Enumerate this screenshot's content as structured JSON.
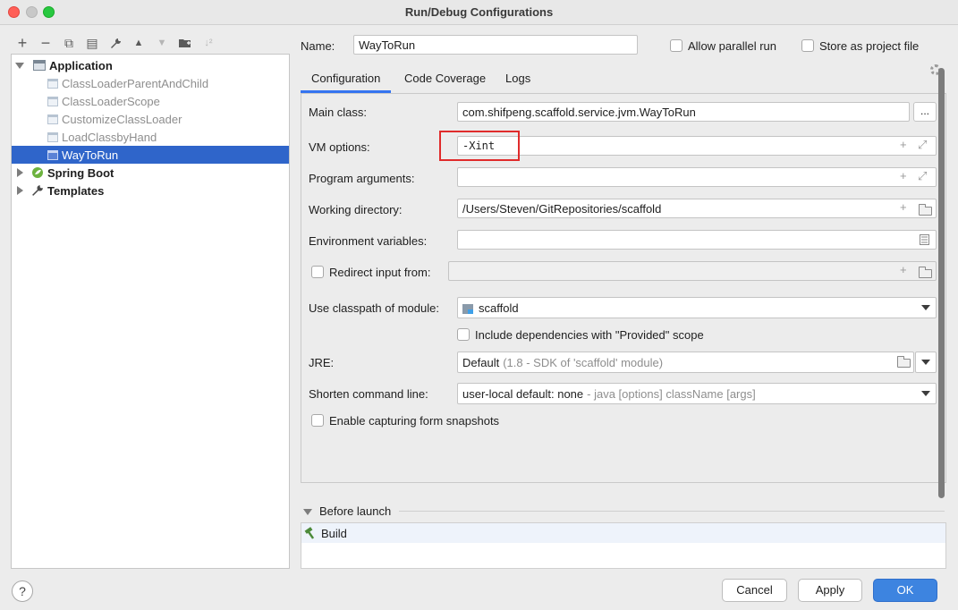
{
  "window": {
    "title": "Run/Debug Configurations"
  },
  "toolbar": {
    "add": "+",
    "remove": "−",
    "copy": "⧉",
    "save": "▤",
    "edit": "🔧",
    "up": "▲",
    "down": "▼",
    "folder": "📁",
    "sort": "↓²"
  },
  "tree": {
    "application": "Application",
    "items": [
      "ClassLoaderParentAndChild",
      "ClassLoaderScope",
      "CustomizeClassLoader",
      "LoadClassbyHand",
      "WayToRun"
    ],
    "spring_boot": "Spring Boot",
    "templates": "Templates"
  },
  "header": {
    "name_label": "Name:",
    "name_value": "WayToRun",
    "allow_parallel": "Allow parallel run",
    "store_project": "Store as project file"
  },
  "tabs": [
    "Configuration",
    "Code Coverage",
    "Logs"
  ],
  "config": {
    "main_class_label": "Main class:",
    "main_class_value": "com.shifpeng.scaffold.service.jvm.WayToRun",
    "more_btn": "...",
    "vm_label": "VM options:",
    "vm_value": "-Xint",
    "prog_args_label": "Program arguments:",
    "prog_args_value": "",
    "workdir_label": "Working directory:",
    "workdir_value": "/Users/Steven/GitRepositories/scaffold",
    "env_label": "Environment variables:",
    "env_value": "",
    "redirect_label": "Redirect input from:",
    "classpath_label": "Use classpath of module:",
    "classpath_value": "scaffold",
    "include_deps": "Include dependencies with \"Provided\" scope",
    "jre_label": "JRE:",
    "jre_value": "Default",
    "jre_detail": "(1.8 - SDK of 'scaffold' module)",
    "shorten_label": "Shorten command line:",
    "shorten_value": "user-local default: none",
    "shorten_detail": "- java [options] className [args]",
    "capture_label": "Enable capturing form snapshots"
  },
  "before_launch": {
    "title": "Before launch",
    "items": [
      "Build"
    ]
  },
  "buttons": {
    "help": "?",
    "cancel": "Cancel",
    "apply": "Apply",
    "ok": "OK"
  },
  "colors": {
    "selection": "#2f65ca",
    "accent": "#3d84e0",
    "highlight_box": "#e02b2b"
  }
}
